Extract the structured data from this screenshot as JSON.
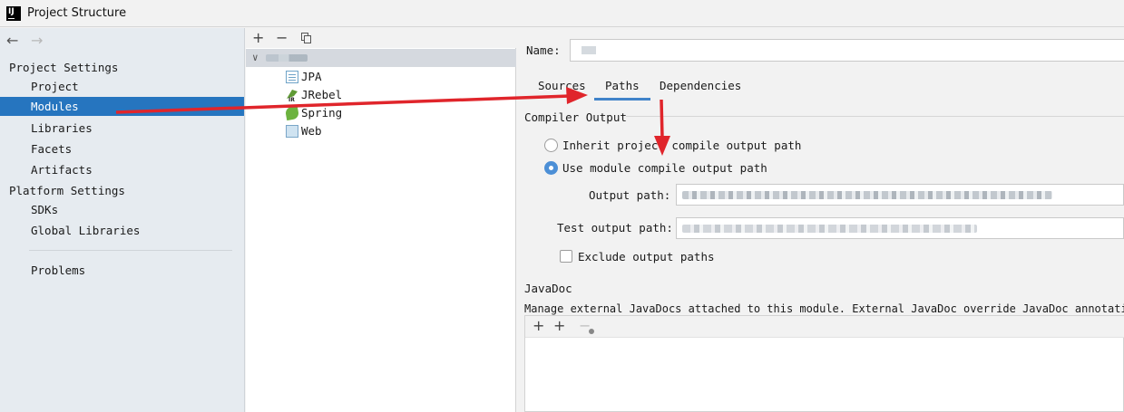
{
  "window": {
    "title": "Project Structure",
    "app_icon": "intellij-icon",
    "app_icon_text": "IJ"
  },
  "nav": {
    "back_icon": "arrow-left-icon",
    "back_glyph": "←",
    "forward_icon": "arrow-right-icon",
    "forward_glyph": "→"
  },
  "sidebar": {
    "project_settings_header": "Project Settings",
    "project_items": [
      "Project",
      "Modules",
      "Libraries",
      "Facets",
      "Artifacts"
    ],
    "selected_item": "Modules",
    "platform_settings_header": "Platform Settings",
    "platform_items": [
      "SDKs",
      "Global Libraries"
    ],
    "problems": "Problems",
    "selection_color": "#2675bf"
  },
  "module_tree": {
    "toolbar": {
      "add_glyph": "+",
      "remove_glyph": "−",
      "copy_icon": "copy-icon"
    },
    "root": {
      "expanded_glyph": "∨"
    },
    "children": [
      {
        "label": "JPA",
        "icon": "jpa-icon"
      },
      {
        "label": "JRebel",
        "icon": "jrebel-icon"
      },
      {
        "label": "Spring",
        "icon": "spring-icon"
      },
      {
        "label": "Web",
        "icon": "web-icon"
      }
    ]
  },
  "module_settings": {
    "name_label": "Name:",
    "tabs": [
      "Sources",
      "Paths",
      "Dependencies"
    ],
    "active_tab": "Paths",
    "compiler_output": {
      "header": "Compiler Output",
      "option_inherit": "Inherit project compile output path",
      "option_module": "Use module compile output path",
      "selected_option": "Use module compile output path",
      "output_path_label": "Output path:",
      "test_output_path_label": "Test output path:",
      "exclude_label": "Exclude output paths",
      "exclude_checked": false
    },
    "javadoc": {
      "header": "JavaDoc",
      "description": "Manage external JavaDocs attached to this module. External JavaDoc override JavaDoc annotations",
      "toolbar": {
        "add_glyph": "+",
        "add_url_glyph": "+",
        "remove_glyph": "−"
      }
    },
    "accent_color": "#4083c9"
  },
  "annotations": {
    "arrow_color": "#e0252b"
  }
}
